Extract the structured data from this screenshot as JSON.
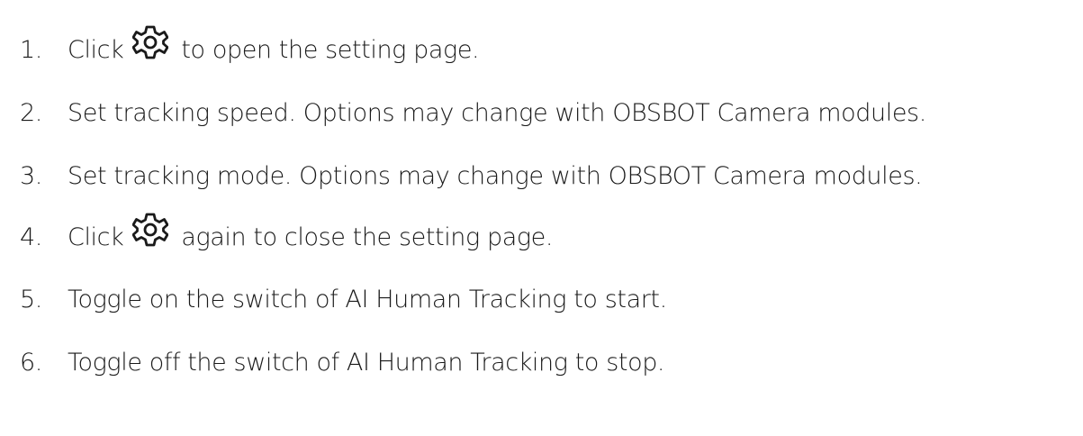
{
  "steps": [
    {
      "num": "1.",
      "before": "Click",
      "icon": "gear-icon",
      "after": "to open the setting page."
    },
    {
      "num": "2.",
      "text": "Set tracking speed. Options may change with OBSBOT Camera modules."
    },
    {
      "num": "3.",
      "text": "Set tracking mode. Options may change with OBSBOT Camera modules."
    },
    {
      "num": "4.",
      "before": "Click",
      "icon": "gear-icon",
      "after": "again to close the setting page."
    },
    {
      "num": "5.",
      "text": "Toggle on the switch of AI Human Tracking to start."
    },
    {
      "num": "6.",
      "text": "Toggle off the switch of AI Human Tracking to stop."
    }
  ],
  "colors": {
    "text": "#1a1a1a",
    "background": "#ffffff"
  }
}
